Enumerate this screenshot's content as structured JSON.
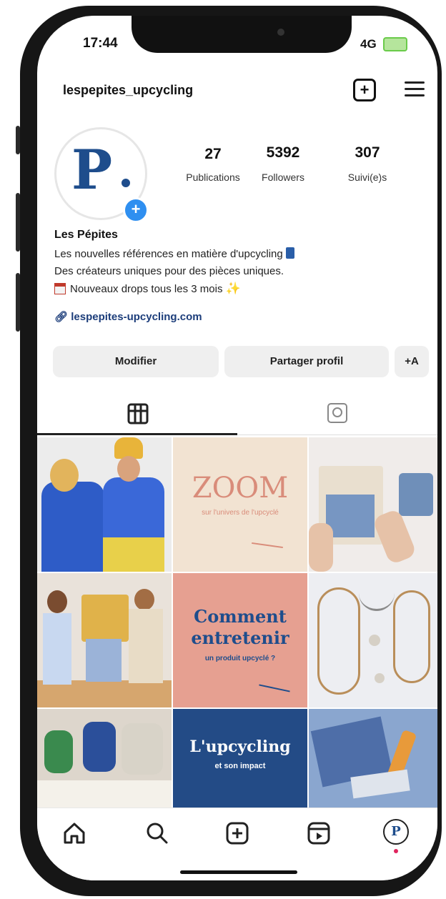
{
  "status_bar": {
    "time": "17:44",
    "network": "4G",
    "battery": ""
  },
  "header": {
    "username": "lespepites_upcycling"
  },
  "profile": {
    "avatar_glyph": "P",
    "stats": [
      {
        "value": "27",
        "label": "Publications"
      },
      {
        "value": "5392",
        "label": "Followers"
      },
      {
        "value": "307",
        "label": "Suivi(e)s"
      }
    ],
    "name": "Les Pépites",
    "bio": [
      "Les nouvelles références en matière d'upcycling",
      "Des créateurs uniques pour des pièces uniques.",
      "Nouveaux drops tous les 3 mois"
    ],
    "link": "lespepites-upcycling.com"
  },
  "actions": {
    "edit": "Modifier",
    "share": "Partager profil",
    "discover": "+A"
  },
  "tabs": {
    "posts_icon": "grid-icon",
    "tagged_icon": "tagged-icon"
  },
  "grid": {
    "post2_title": "ZOOM",
    "post2_sub": "sur l'univers de l'upcyclé",
    "post5_title1": "Comment",
    "post5_title2": "entretenir",
    "post5_sub": "un produit upcyclé ?",
    "post8_title": "L'upcycling",
    "post8_sub": "et son impact"
  },
  "colors": {
    "brand_blue": "#1e4d8c",
    "zoom_bg": "#f2e3d2",
    "zoom_text": "#d98c7a",
    "salmon": "#e6a091",
    "navy": "#234b86"
  },
  "nav": [
    "home-icon",
    "search-icon",
    "create-icon",
    "reels-icon",
    "profile-icon"
  ]
}
